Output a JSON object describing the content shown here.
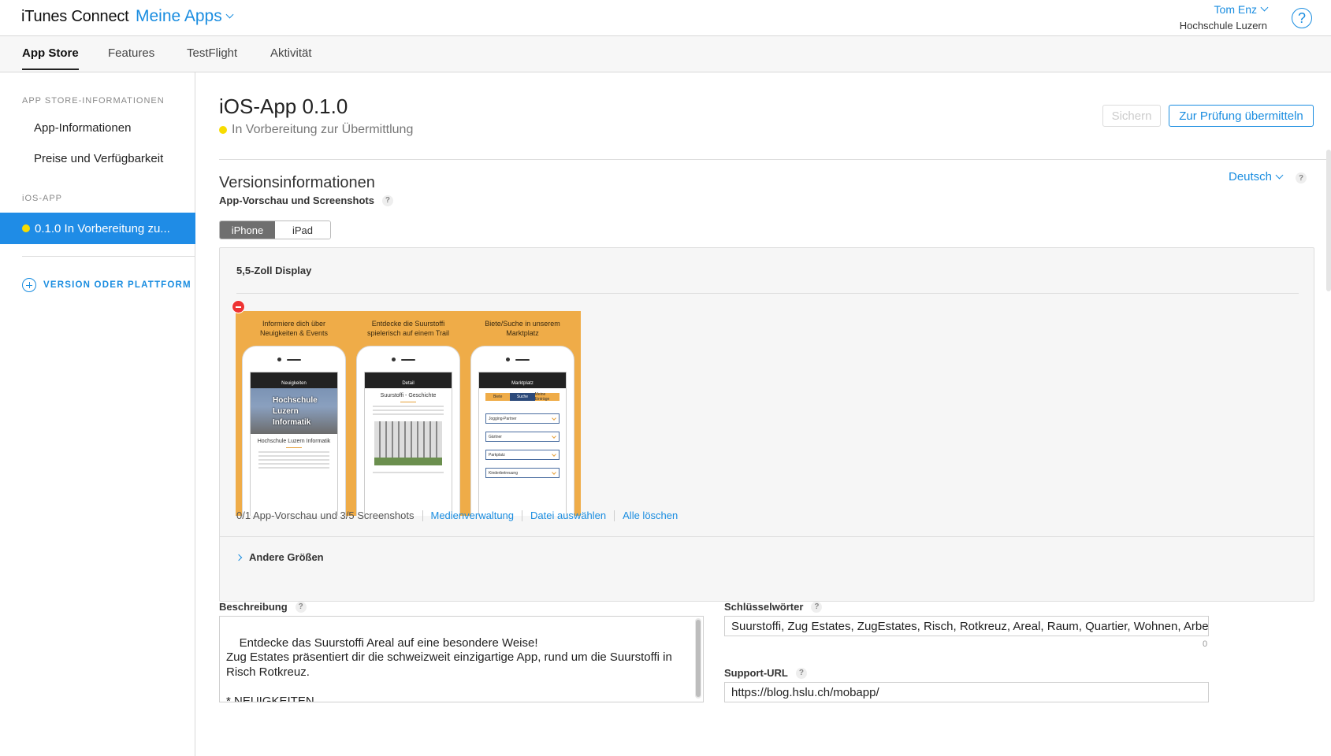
{
  "header": {
    "brand": "iTunes Connect",
    "my_apps": "Meine Apps",
    "user_name": "Tom Enz",
    "user_org": "Hochschule Luzern",
    "help_icon": "?"
  },
  "tabs": [
    {
      "label": "App Store",
      "active": true
    },
    {
      "label": "Features",
      "active": false
    },
    {
      "label": "TestFlight",
      "active": false
    },
    {
      "label": "Aktivität",
      "active": false
    }
  ],
  "sidebar": {
    "section_store": "APP STORE-INFORMATIONEN",
    "items": [
      "App-Informationen",
      "Preise und Verfügbarkeit"
    ],
    "section_ios": "iOS-APP",
    "active_item": "0.1.0 In Vorbereitung zu...",
    "add_version": "VERSION ODER PLATTFORM"
  },
  "main": {
    "title": "iOS-App 0.1.0",
    "status": "In Vorbereitung zur Übermittlung",
    "save_label": "Sichern",
    "submit_label": "Zur Prüfung übermitteln",
    "section_title": "Versionsinformationen",
    "language": "Deutsch",
    "previews_label": "App-Vorschau und Screenshots",
    "device_tabs": [
      "iPhone",
      "iPad"
    ],
    "display_label": "5,5-Zoll Display",
    "screenshots": [
      {
        "caption": "Informiere dich über Neuigkeiten & Events",
        "screen_title": "Neuigkeiten",
        "image_text": "Hochschule Luzern Informatik",
        "heading": "Hochschule Luzern Informatik"
      },
      {
        "caption": "Entdecke die Suurstoffi spielerisch auf einem Trail",
        "screen_title": "Detail",
        "heading": "Suurstoffi - Geschichte"
      },
      {
        "caption": "Biete/Suche in unserem Marktplatz",
        "screen_title": "Marktplatz",
        "segments": [
          "Biete",
          "Suche",
          "Meine Einträge"
        ],
        "dropdowns": [
          "Jogging-Partner",
          "Gärtner",
          "Parkplatz",
          "Kinderbetreuung"
        ]
      }
    ],
    "shots_count": "0/1 App-Vorschau und 3/5 Screenshots",
    "media_link": "Medienverwaltung",
    "choose_file_link": "Datei auswählen",
    "delete_all_link": "Alle löschen",
    "other_sizes": "Andere Größen",
    "description_label": "Beschreibung",
    "description_value": "Entdecke das Suurstoffi Areal auf eine besondere Weise!\nZug Estates präsentiert dir die schweizweit einzigartige App, rund um die Suurstoffi in Risch Rotkreuz.\n\n* NEUIGKEITEN\nInformiere dich über die Neuigkeiten & Events rund um einen Quarzier auch ohne dabei",
    "keywords_label": "Schlüsselwörter",
    "keywords_value": "Suurstoffi, Zug Estates, ZugEstates, Risch, Rotkreuz, Areal, Raum, Quartier, Wohnen, Arbeiten",
    "keywords_counter": "0",
    "support_label": "Support-URL",
    "support_value": "https://blog.hslu.ch/mobapp/"
  },
  "colors": {
    "accent": "#1a8de0",
    "sidebar_active": "#1f8ce6",
    "status_dot": "#f7dc00",
    "screenshot_bg": "#efac48",
    "delete": "#e33333"
  }
}
